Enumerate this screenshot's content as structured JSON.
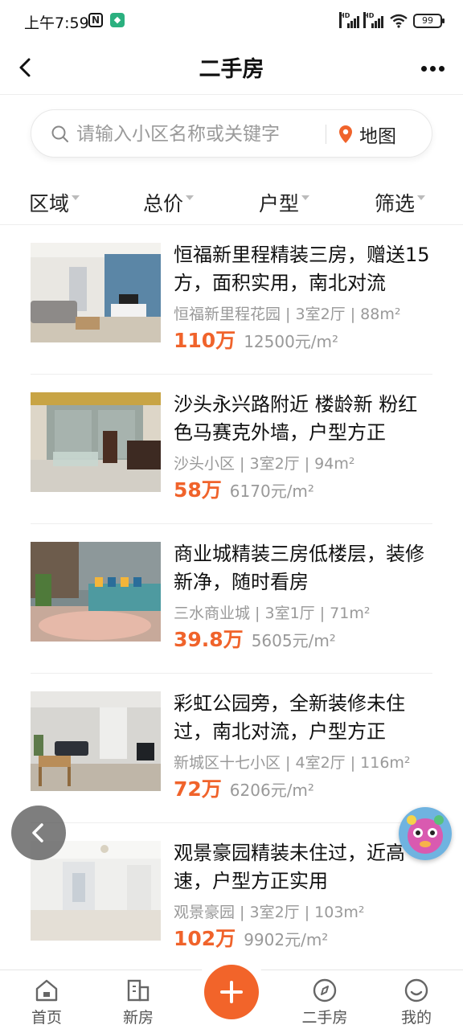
{
  "status_bar": {
    "time": "上午7:59",
    "battery": "99"
  },
  "header": {
    "title": "二手房"
  },
  "search": {
    "placeholder": "请输入小区名称或关键字",
    "map_label": "地图"
  },
  "filters": [
    "区域",
    "总价",
    "户型",
    "筛选"
  ],
  "listings": [
    {
      "title": "恒福新里程精装三房，赠送15方，面积实用，南北对流",
      "meta": "恒福新里程花园 | 3室2厅 | 88m²",
      "price": "110万",
      "unit_price": "12500元/m²"
    },
    {
      "title": "沙头永兴路附近 楼龄新 粉红色马赛克外墙，户型方正",
      "meta": "沙头小区 | 3室2厅 | 94m²",
      "price": "58万",
      "unit_price": "6170元/m²"
    },
    {
      "title": "商业城精装三房低楼层，装修新净，随时看房",
      "meta": "三水商业城 | 3室1厅 | 71m²",
      "price": "39.8万",
      "unit_price": "5605元/m²"
    },
    {
      "title": "彩虹公园旁，全新装修未住过，南北对流，户型方正",
      "meta": "新城区十七小区 | 4室2厅 | 116m²",
      "price": "72万",
      "unit_price": "6206元/m²"
    },
    {
      "title": "观景豪园精装未住过，近高速，户型方正实用",
      "meta": "观景豪园 | 3室2厅 | 103m²",
      "price": "102万",
      "unit_price": "9902元/m²"
    }
  ],
  "tabbar": {
    "home": "首页",
    "new_house": "新房",
    "second_hand": "二手房",
    "mine": "我的"
  }
}
